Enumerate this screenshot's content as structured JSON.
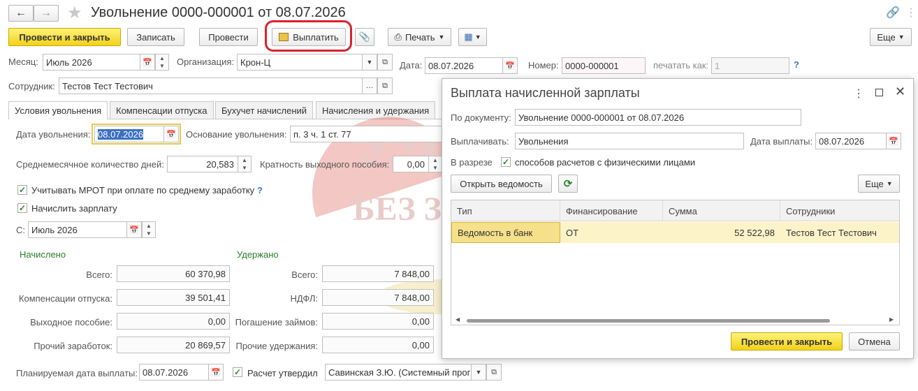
{
  "window": {
    "title": "Увольнение 0000-000001 от 08.07.2026"
  },
  "toolbar": {
    "post_close": "Провести и закрыть",
    "save": "Записать",
    "post": "Провести",
    "pay": "Выплатить",
    "print": "Печать",
    "more": "Еще"
  },
  "header": {
    "month_label": "Месяц:",
    "month_value": "Июль 2026",
    "org_label": "Организация:",
    "org_value": "Крон-Ц",
    "date_label": "Дата:",
    "date_value": "08.07.2026",
    "number_label": "Номер:",
    "number_value": "0000-000001",
    "print_as_label": "печатать как:",
    "print_as_placeholder": "1",
    "employee_label": "Сотрудник:",
    "employee_value": "Тестов Тест Тестович",
    "help": "?"
  },
  "tabs": [
    "Условия увольнения",
    "Компенсации отпуска",
    "Бухучет начислений",
    "Начисления и удержания"
  ],
  "conditions": {
    "dismiss_date_label": "Дата увольнения:",
    "dismiss_date_value": "08.07.2026",
    "basis_label": "Основание увольнения:",
    "basis_value": "п. 3 ч. 1 ст. 77",
    "avg_days_label": "Среднемесячное количество дней:",
    "avg_days_value": "20,583",
    "severance_mult_label": "Кратность выходного пособия:",
    "severance_mult_value": "0,00",
    "mrot_label": "Учитывать МРОТ при оплате по среднему заработку",
    "accrue_label": "Начислить зарплату",
    "from_label": "С:",
    "from_value": "Июль 2026"
  },
  "accrued": {
    "title": "Начислено",
    "rows": [
      {
        "label": "Всего:",
        "value": "60 370,98"
      },
      {
        "label": "Компенсации отпуска:",
        "value": "39 501,41"
      },
      {
        "label": "Выходное пособие:",
        "value": "0,00"
      },
      {
        "label": "Прочий заработок:",
        "value": "20 869,57"
      }
    ]
  },
  "withheld": {
    "title": "Удержано",
    "rows": [
      {
        "label": "Всего:",
        "value": "7 848,00"
      },
      {
        "label": "НДФЛ:",
        "value": "7 848,00"
      },
      {
        "label": "Погашение займов:",
        "value": "0,00"
      },
      {
        "label": "Прочие удержания:",
        "value": "0,00"
      }
    ]
  },
  "footer": {
    "pay_date_label": "Планируемая дата выплаты:",
    "pay_date_value": "08.07.2026",
    "approved_label": "Расчет утвердил",
    "approved_value": "Савинская З.Ю. (Системный прог"
  },
  "watermark": {
    "line1": "УЧЕТ",
    "line2": "БЕЗ ЗАБОТ"
  },
  "modal": {
    "title": "Выплата начисленной зарплаты",
    "doc_label": "По документу:",
    "doc_value": "Увольнение 0000-000001 от 08.07.2026",
    "pay_label": "Выплачивать:",
    "pay_value": "Увольнения",
    "pay_date_label": "Дата выплаты:",
    "pay_date_value": "08.07.2026",
    "breakdown_label": "В разрезе",
    "breakdown_check_label": "способов расчетов с физическими лицами",
    "open_statement": "Открыть ведомость",
    "more": "Еще",
    "columns": [
      "Тип",
      "Финансирование",
      "Сумма",
      "Сотрудники"
    ],
    "rows": [
      {
        "type": "Ведомость в банк",
        "financing": "ОТ",
        "amount": "52 522,98",
        "employees": "Тестов Тест Тестович"
      }
    ],
    "post_close": "Провести и закрыть",
    "cancel": "Отмена"
  }
}
